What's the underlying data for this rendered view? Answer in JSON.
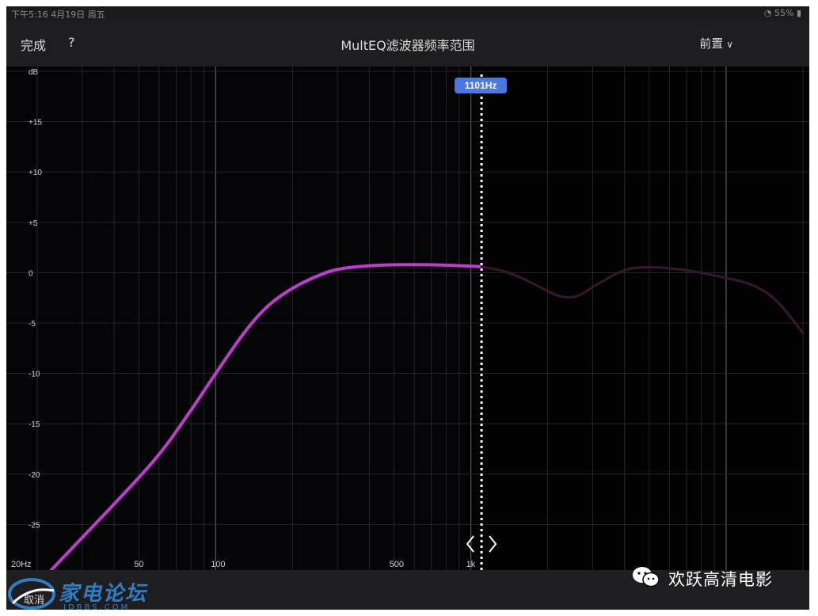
{
  "status_bar": {
    "left": "下午5:16 4月19日 周五",
    "right": "55%"
  },
  "nav": {
    "done_label": "完成",
    "help_label": "?",
    "title": "MultEQ滤波器频率范围",
    "preset_label": "前置"
  },
  "bottom": {
    "cancel_label": "取消"
  },
  "cursor": {
    "label": "1101Hz"
  },
  "watermark": {
    "site_name": "家电论坛",
    "site_domain": "JDBBS.COM",
    "wechat_account": "欢跃高清电影"
  },
  "colors": {
    "curve": "#c33ad0",
    "curve_dim": "#3a1730",
    "cursor_tag": "#4a78e0",
    "background": "#050407",
    "navbar": "#1e1e20"
  },
  "icons": {
    "wifi": "wifi-icon",
    "battery": "battery-icon",
    "chevron": "chevron-down-icon",
    "handle": "drag-handle-icon",
    "wechat": "wechat-icon"
  },
  "chart_data": {
    "type": "line",
    "title": "",
    "xlabel": "",
    "ylabel": "dB",
    "x_scale": "log",
    "xlim": [
      20,
      20000
    ],
    "ylim": [
      -30,
      20
    ],
    "x_ticks": [
      {
        "value": 20,
        "label": "20Hz"
      },
      {
        "value": 50,
        "label": "50"
      },
      {
        "value": 100,
        "label": "100"
      },
      {
        "value": 500,
        "label": "500"
      },
      {
        "value": 1000,
        "label": "1k"
      }
    ],
    "y_ticks": [
      {
        "value": 20,
        "label": "dB"
      },
      {
        "value": 15,
        "label": "+15"
      },
      {
        "value": 10,
        "label": "+10"
      },
      {
        "value": 5,
        "label": "+5"
      },
      {
        "value": 0,
        "label": "0"
      },
      {
        "value": -5,
        "label": "-5"
      },
      {
        "value": -10,
        "label": "-10"
      },
      {
        "value": -15,
        "label": "-15"
      },
      {
        "value": -20,
        "label": "-20"
      },
      {
        "value": -25,
        "label": "-25"
      }
    ],
    "grid": true,
    "cursor_x": 1101,
    "series": [
      {
        "style": "active",
        "x": [
          20,
          30,
          40,
          60,
          80,
          100,
          130,
          160,
          200,
          250,
          300,
          400,
          500,
          700,
          900,
          1101
        ],
        "y": [
          -31,
          -26.3,
          -23,
          -18.2,
          -13.7,
          -10,
          -5.8,
          -3.2,
          -1.5,
          -0.3,
          0.4,
          0.7,
          0.8,
          0.8,
          0.7,
          0.6
        ]
      },
      {
        "style": "dimmed",
        "x": [
          1101,
          1400,
          1800,
          2200,
          2600,
          3000,
          4000,
          5000,
          7000,
          10000,
          13000,
          16000,
          20000
        ],
        "y": [
          0.6,
          0.1,
          -1.2,
          -2.4,
          -2.5,
          -1.4,
          0.4,
          0.6,
          0.3,
          -0.5,
          -1.2,
          -2.8,
          -6
        ]
      }
    ]
  }
}
